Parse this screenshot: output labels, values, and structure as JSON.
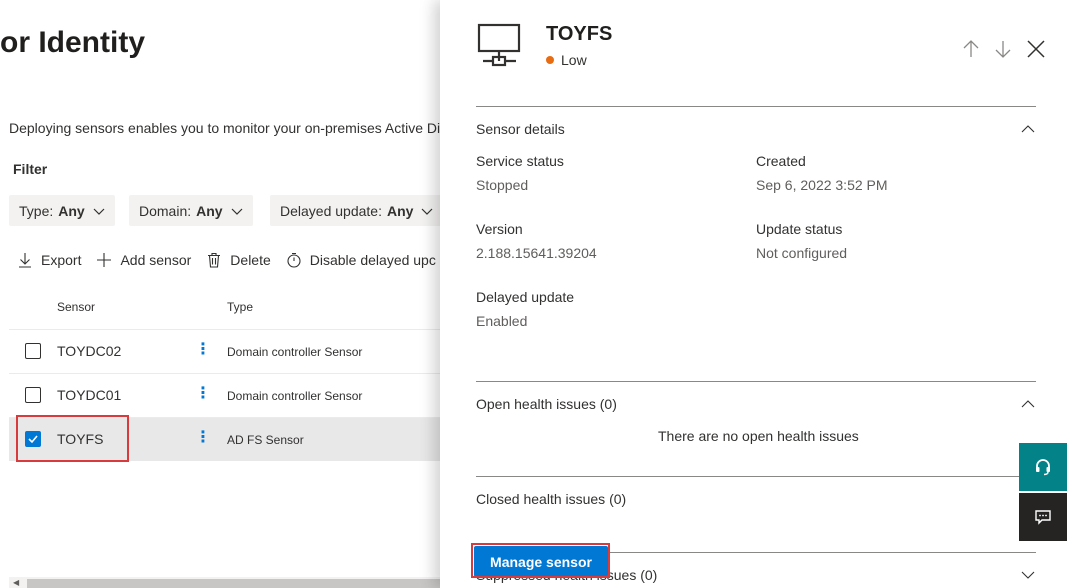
{
  "page": {
    "title": "or Identity",
    "description": "Deploying sensors enables you to monitor your on-premises Active Di"
  },
  "filter": {
    "label": "Filter",
    "pills": [
      {
        "key": "Type:",
        "value": "Any"
      },
      {
        "key": "Domain:",
        "value": "Any"
      },
      {
        "key": "Delayed update:",
        "value": "Any"
      }
    ]
  },
  "toolbar": {
    "export": "Export",
    "add_sensor": "Add sensor",
    "delete": "Delete",
    "disable_delayed": "Disable delayed upc"
  },
  "table": {
    "headers": {
      "sensor": "Sensor",
      "type": "Type"
    },
    "rows": [
      {
        "name": "TOYDC02",
        "type": "Domain controller Sensor",
        "selected": false
      },
      {
        "name": "TOYDC01",
        "type": "Domain controller Sensor",
        "selected": false
      },
      {
        "name": "TOYFS",
        "type": "AD FS Sensor",
        "selected": true
      }
    ]
  },
  "panel": {
    "title": "TOYFS",
    "severity": "Low",
    "severity_color": "#e86c12",
    "sensor_details": {
      "heading": "Sensor details",
      "service_status_label": "Service status",
      "service_status": "Stopped",
      "created_label": "Created",
      "created": "Sep 6, 2022 3:52 PM",
      "version_label": "Version",
      "version": "2.188.15641.39204",
      "update_status_label": "Update status",
      "update_status": "Not configured",
      "delayed_update_label": "Delayed update",
      "delayed_update": "Enabled"
    },
    "open_health": {
      "heading": "Open health issues (0)",
      "empty": "There are no open health issues"
    },
    "closed_health": {
      "heading": "Closed health issues (0)"
    },
    "suppressed_health": {
      "heading": "Suppressed health issues (0)"
    },
    "manage_button": "Manage sensor"
  },
  "colors": {
    "accent": "#0078d4",
    "teal": "#038387",
    "dark": "#252423",
    "highlight": "#d83b3b"
  },
  "icons": {
    "device": "computer-network-icon",
    "up": "arrow-up-icon",
    "down": "arrow-down-icon",
    "close": "close-icon",
    "help": "headset-icon",
    "feedback": "feedback-icon"
  }
}
